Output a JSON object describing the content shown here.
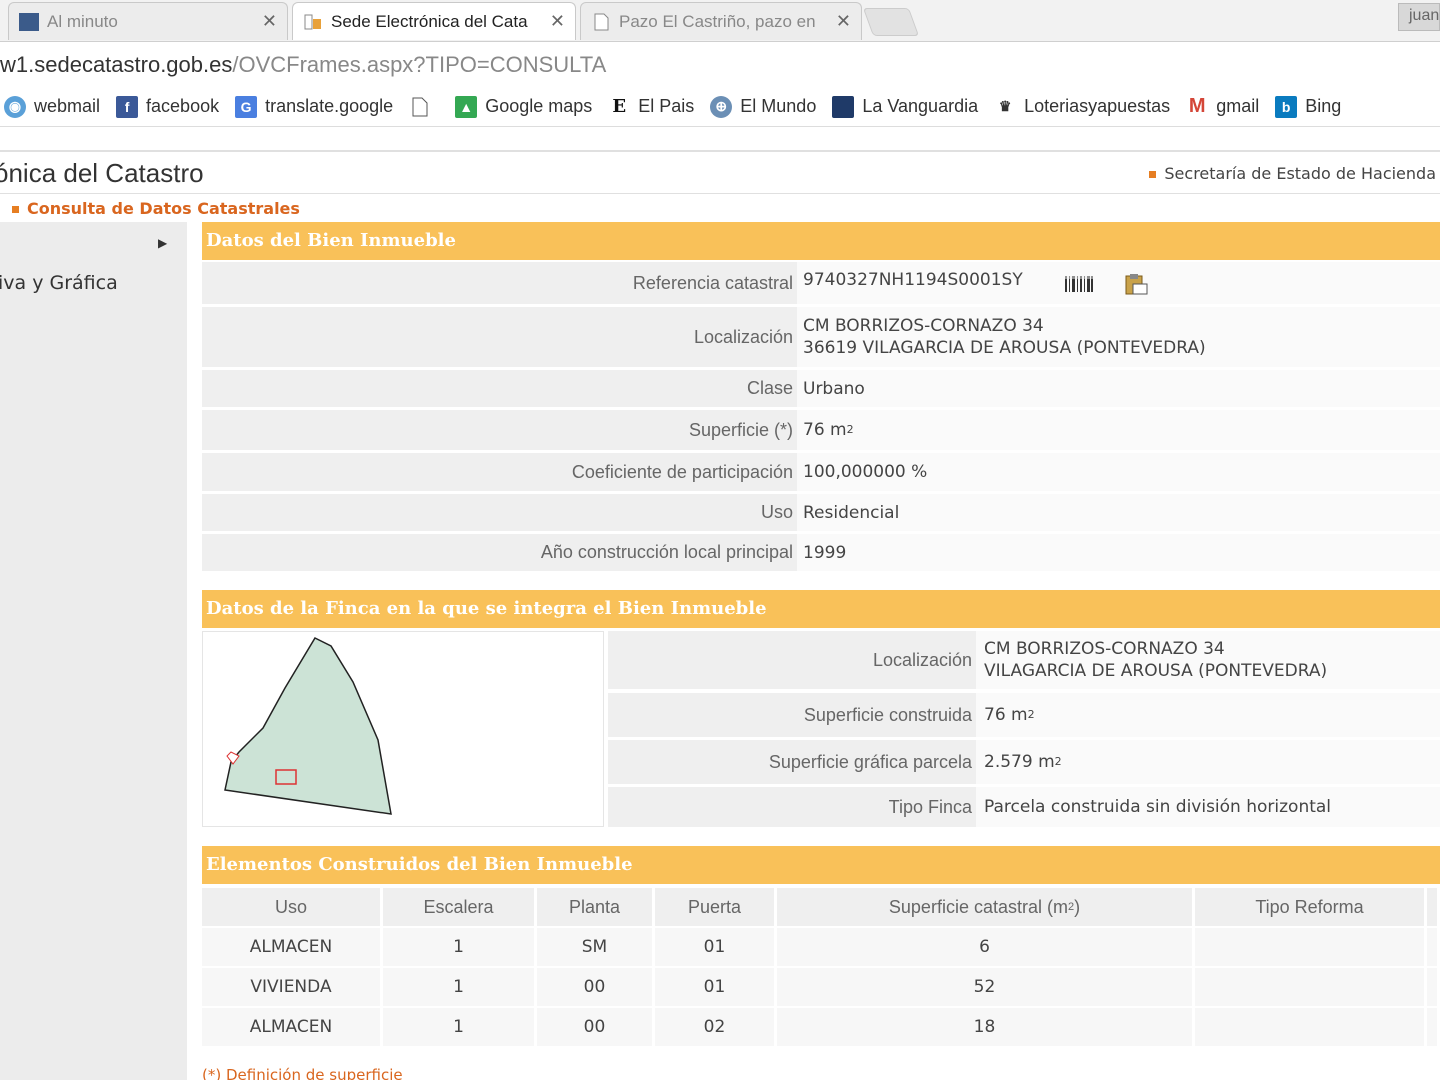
{
  "browser": {
    "tabs": [
      {
        "title": "Al minuto",
        "active": false
      },
      {
        "title": "Sede Electrónica del Cata",
        "active": true
      },
      {
        "title": "Pazo El Castriño, pazo en",
        "active": false
      }
    ],
    "user_button": "juan",
    "url_host": "w1.sedecatastro.gob.es",
    "url_path": "/OVCFrames.aspx?TIPO=CONSULTA",
    "bookmarks": [
      {
        "label": "webmail",
        "icon": "webmail-icon"
      },
      {
        "label": "facebook",
        "icon": "facebook-icon"
      },
      {
        "label": "translate.google",
        "icon": "translate-icon"
      },
      {
        "label": "",
        "icon": "page-icon"
      },
      {
        "label": "Google maps",
        "icon": "maps-icon"
      },
      {
        "label": "El Pais",
        "icon": "elpais-icon"
      },
      {
        "label": "El Mundo",
        "icon": "globe-icon"
      },
      {
        "label": "La Vanguardia",
        "icon": "vanguardia-icon"
      },
      {
        "label": "Loteriasyapuestas",
        "icon": "loteria-icon"
      },
      {
        "label": "gmail",
        "icon": "gmail-icon"
      },
      {
        "label": "Bing",
        "icon": "bing-icon"
      }
    ]
  },
  "header": {
    "site_title": "ónica del Catastro",
    "ministry": "Secretaría de Estado de Hacienda",
    "breadcrumb": "Consulta de Datos Catastrales"
  },
  "nav": {
    "item": "iva y Gráfica"
  },
  "bien": {
    "title": "Datos del Bien Inmueble",
    "ref_label": "Referencia catastral",
    "ref_value": "9740327NH1194S0001SY",
    "loc_label": "Localización",
    "loc_line1": "CM BORRIZOS-CORNAZO 34",
    "loc_line2": "36619 VILAGARCIA DE AROUSA (PONTEVEDRA)",
    "clase_label": "Clase",
    "clase_value": "Urbano",
    "sup_label": "Superficie (*)",
    "sup_value": "76 m",
    "coef_label": "Coeficiente de participación",
    "coef_value": "100,000000 %",
    "uso_label": "Uso",
    "uso_value": "Residencial",
    "anio_label": "Año construcción local principal",
    "anio_value": "1999"
  },
  "finca": {
    "title": "Datos de la Finca en la que se integra el Bien Inmueble",
    "loc_label": "Localización",
    "loc_line1": "CM BORRIZOS-CORNAZO 34",
    "loc_line2": "VILAGARCIA DE AROUSA (PONTEVEDRA)",
    "sup_const_label": "Superficie construida",
    "sup_const_value": "76 m",
    "sup_graf_label": "Superficie gráfica parcela",
    "sup_graf_value": "2.579 m",
    "tipo_label": "Tipo Finca",
    "tipo_value": "Parcela construida sin división horizontal"
  },
  "elementos": {
    "title": "Elementos Construidos del Bien Inmueble",
    "headers": [
      "Uso",
      "Escalera",
      "Planta",
      "Puerta",
      "Superficie catastral (m",
      "Tipo Reforma"
    ],
    "rows": [
      [
        "ALMACEN",
        "1",
        "SM",
        "01",
        "6",
        ""
      ],
      [
        "VIVIENDA",
        "1",
        "00",
        "01",
        "52",
        ""
      ],
      [
        "ALMACEN",
        "1",
        "00",
        "02",
        "18",
        ""
      ]
    ]
  },
  "footnote": "(*) Definición de superficie",
  "colors": {
    "accent": "#f9c159",
    "orange": "#d9661f",
    "parcel_fill": "#cce3d6"
  }
}
